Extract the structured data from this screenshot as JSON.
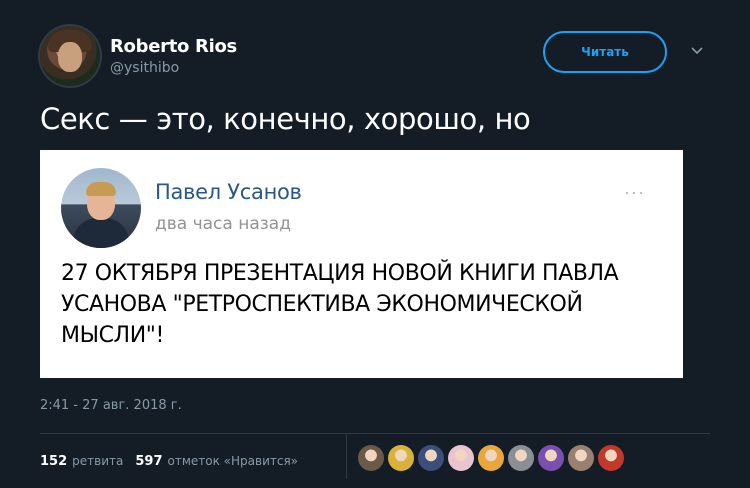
{
  "user": {
    "name": "Roberto Rios",
    "handle": "@ysithibo"
  },
  "follow_label": "Читать",
  "tweet": {
    "text": "Секс — это, конечно, хорошо, но",
    "timestamp": "2:41 - 27 авг. 2018 г."
  },
  "embed": {
    "author": "Павел Усанов",
    "time": "два часа назад",
    "more": "···",
    "body": "27 ОКТЯБРЯ ПРЕЗЕНТАЦИЯ НОВОЙ КНИГИ ПАВЛА УСАНОВА \"РЕТРОСПЕКТИВА ЭКОНОМИЧЕСКОЙ МЫСЛИ\"!"
  },
  "stats": {
    "retweets_count": "152",
    "retweets_label": "ретвита",
    "likes_count": "597",
    "likes_label": "отметок «Нравится»"
  },
  "likers": [
    {
      "name": "liker-avatar-1",
      "color": "#6b5a4a"
    },
    {
      "name": "liker-avatar-2",
      "color": "#d9b23a"
    },
    {
      "name": "liker-avatar-3",
      "color": "#3b4f7a"
    },
    {
      "name": "liker-avatar-4",
      "color": "#e7c4d0"
    },
    {
      "name": "liker-avatar-5",
      "color": "#e9a63f"
    },
    {
      "name": "liker-avatar-6",
      "color": "#8a8f96"
    },
    {
      "name": "liker-avatar-7",
      "color": "#7a4fb0"
    },
    {
      "name": "liker-avatar-8",
      "color": "#9a8070"
    },
    {
      "name": "liker-avatar-9",
      "color": "#c0392b"
    }
  ],
  "colors": {
    "background": "#141d26",
    "accent": "#1da1f2",
    "muted": "#8899a6",
    "embed_link": "#2a5885"
  }
}
